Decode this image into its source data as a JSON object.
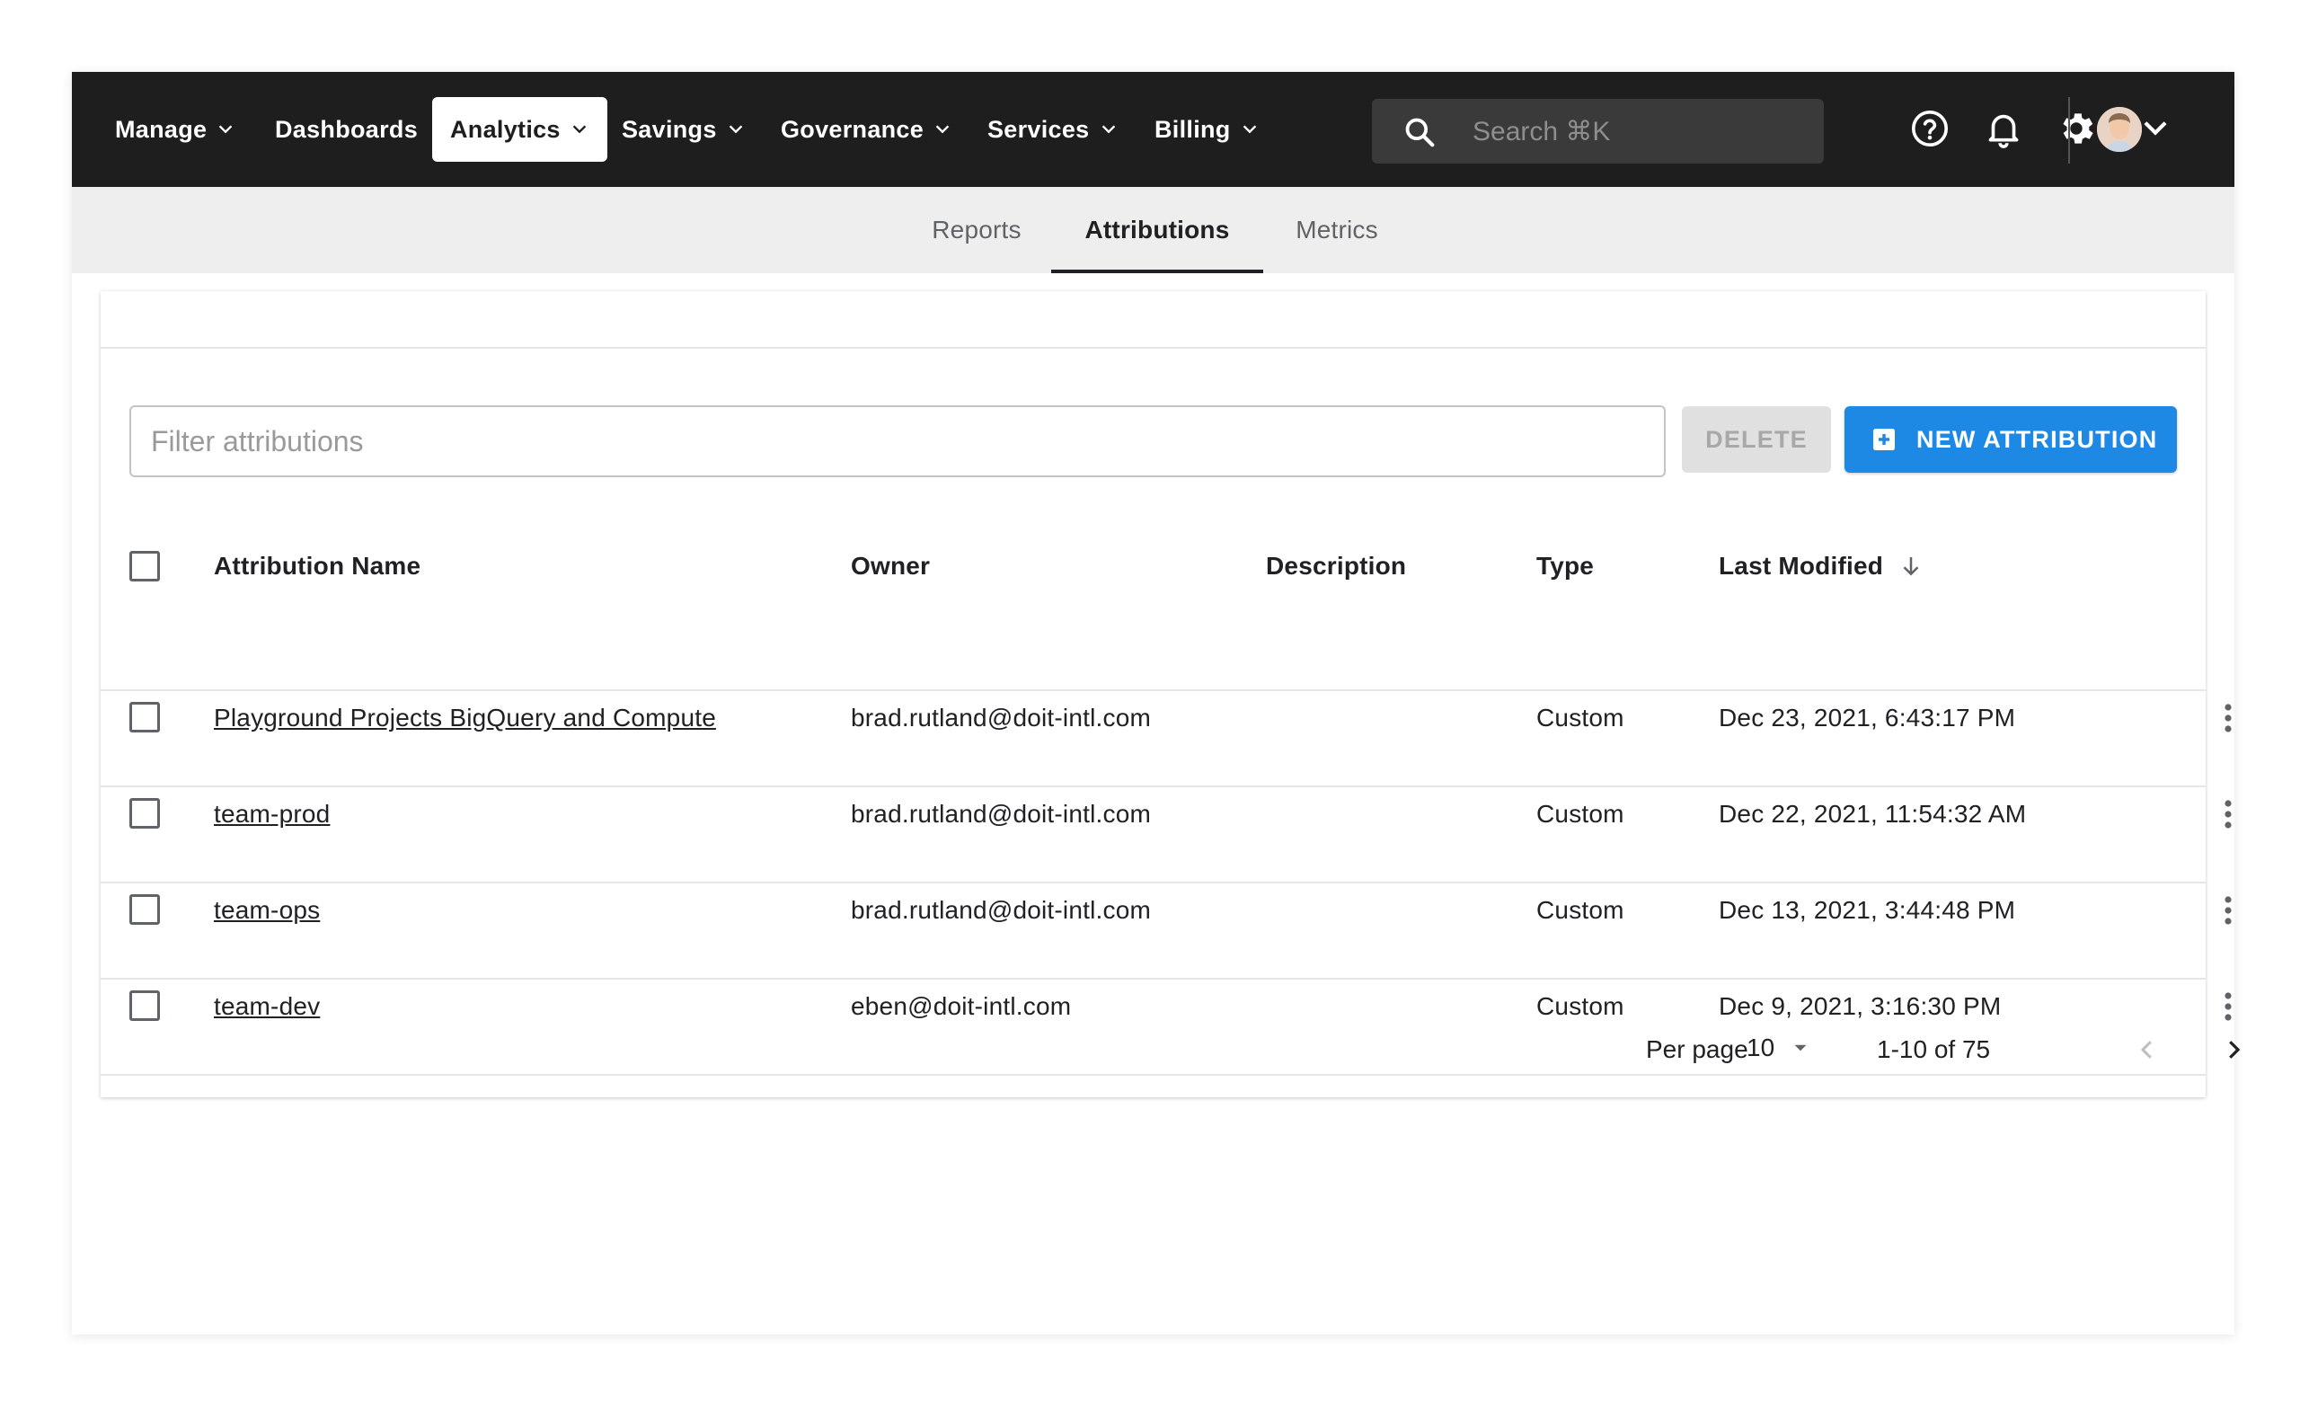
{
  "nav": {
    "items": [
      {
        "label": "Manage",
        "dropdown": true
      },
      {
        "label": "Dashboards",
        "dropdown": false
      },
      {
        "label": "Analytics",
        "dropdown": true,
        "active": true
      },
      {
        "label": "Savings",
        "dropdown": true
      },
      {
        "label": "Governance",
        "dropdown": true
      },
      {
        "label": "Services",
        "dropdown": true
      },
      {
        "label": "Billing",
        "dropdown": true
      }
    ],
    "search_placeholder": "Search ⌘K",
    "icons": [
      "help-icon",
      "bell-icon",
      "gear-icon"
    ],
    "colors": {
      "bar": "#1e1e1e",
      "search_bg": "#3a3a3a"
    }
  },
  "subtabs": [
    {
      "label": "Reports",
      "active": false
    },
    {
      "label": "Attributions",
      "active": true
    },
    {
      "label": "Metrics",
      "active": false
    }
  ],
  "toolbar": {
    "filter_placeholder": "Filter attributions",
    "delete_label": "DELETE",
    "new_label": "NEW ATTRIBUTION",
    "accent": "#1e88e5"
  },
  "table": {
    "headers": {
      "name": "Attribution Name",
      "owner": "Owner",
      "description": "Description",
      "type": "Type",
      "modified": "Last Modified"
    },
    "sort_icon": "arrow-down-icon",
    "rows": [
      {
        "name": "Playground Projects BigQuery and Compute",
        "owner": "brad.rutland@doit-intl.com",
        "description": "",
        "type": "Custom",
        "modified": "Dec 23, 2021, 6:43:17 PM"
      },
      {
        "name": "team-prod",
        "owner": "brad.rutland@doit-intl.com",
        "description": "",
        "type": "Custom",
        "modified": "Dec 22, 2021, 11:54:32 AM"
      },
      {
        "name": "team-ops",
        "owner": "brad.rutland@doit-intl.com",
        "description": "",
        "type": "Custom",
        "modified": "Dec 13, 2021, 3:44:48 PM"
      },
      {
        "name": "team-dev",
        "owner": "eben@doit-intl.com",
        "description": "",
        "type": "Custom",
        "modified": "Dec 9, 2021, 3:16:30 PM"
      }
    ]
  },
  "pagination": {
    "per_page_label": "Per page",
    "per_page_value": "10",
    "range": "1-10 of 75"
  }
}
